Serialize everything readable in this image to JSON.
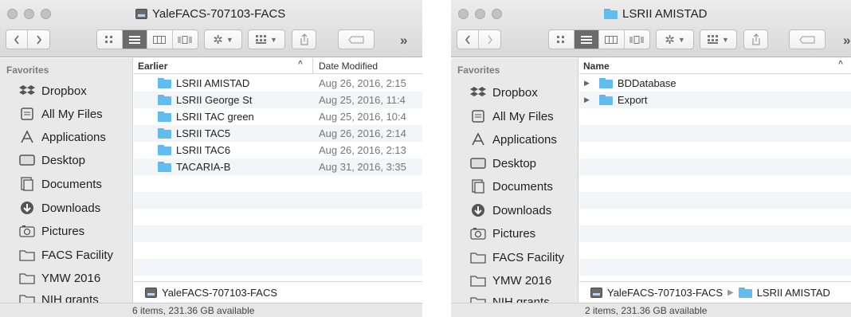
{
  "window1": {
    "title": "YaleFACS-707103-FACS",
    "favorites_label": "Favorites",
    "sidebar": [
      {
        "label": "Dropbox",
        "icon": "dropbox-icon"
      },
      {
        "label": "All My Files",
        "icon": "all-files-icon"
      },
      {
        "label": "Applications",
        "icon": "applications-icon"
      },
      {
        "label": "Desktop",
        "icon": "desktop-icon"
      },
      {
        "label": "Documents",
        "icon": "documents-icon"
      },
      {
        "label": "Downloads",
        "icon": "downloads-icon"
      },
      {
        "label": "Pictures",
        "icon": "pictures-icon"
      },
      {
        "label": "FACS Facility",
        "icon": "folder-icon"
      },
      {
        "label": "YMW 2016",
        "icon": "folder-icon"
      },
      {
        "label": "NIH grants",
        "icon": "folder-icon"
      }
    ],
    "columns": {
      "name": "Earlier",
      "date": "Date Modified"
    },
    "files": [
      {
        "name": "LSRII AMISTAD",
        "date": "Aug 26, 2016, 2:15"
      },
      {
        "name": "LSRII George St",
        "date": "Aug 25, 2016, 11:4"
      },
      {
        "name": "LSRII TAC green",
        "date": "Aug 25, 2016, 10:4"
      },
      {
        "name": "LSRII TAC5",
        "date": "Aug 26, 2016, 2:14"
      },
      {
        "name": "LSRII TAC6",
        "date": "Aug 26, 2016, 2:13"
      },
      {
        "name": "TACARIA-B",
        "date": "Aug 31, 2016, 3:35"
      }
    ],
    "path": [
      "YaleFACS-707103-FACS"
    ],
    "status": "6 items, 231.36 GB available"
  },
  "window2": {
    "title": "LSRII AMISTAD",
    "favorites_label": "Favorites",
    "sidebar": [
      {
        "label": "Dropbox",
        "icon": "dropbox-icon"
      },
      {
        "label": "All My Files",
        "icon": "all-files-icon"
      },
      {
        "label": "Applications",
        "icon": "applications-icon"
      },
      {
        "label": "Desktop",
        "icon": "desktop-icon"
      },
      {
        "label": "Documents",
        "icon": "documents-icon"
      },
      {
        "label": "Downloads",
        "icon": "downloads-icon"
      },
      {
        "label": "Pictures",
        "icon": "pictures-icon"
      },
      {
        "label": "FACS Facility",
        "icon": "folder-icon"
      },
      {
        "label": "YMW 2016",
        "icon": "folder-icon"
      },
      {
        "label": "NIH grants",
        "icon": "folder-icon"
      }
    ],
    "columns": {
      "name": "Name"
    },
    "files": [
      {
        "name": "BDDatabase"
      },
      {
        "name": "Export"
      }
    ],
    "path": [
      "YaleFACS-707103-FACS",
      "LSRII AMISTAD"
    ],
    "status": "2 items, 231.36 GB available"
  },
  "toolbar": {
    "back_icon": "chevron-left-icon",
    "forward_icon": "chevron-right-icon",
    "overflow": "»"
  },
  "colors": {
    "folder": "#61bdf0",
    "sidebar_bg": "#e9e9ea",
    "selected_segment": "#6b6b6b"
  }
}
